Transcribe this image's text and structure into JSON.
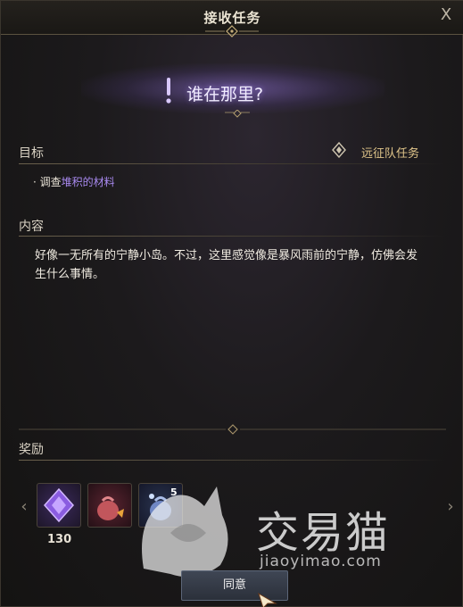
{
  "window": {
    "title": "接收任务",
    "close_label": "X"
  },
  "quest": {
    "name": "谁在那里?",
    "type_label": "远征队任务"
  },
  "objective": {
    "label": "目标",
    "bullet": "·",
    "prefix": "调查",
    "highlight": "堆积的材料"
  },
  "content": {
    "label": "内容",
    "text": "好像一无所有的宁静小岛。不过，这里感觉像是暴风雨前的宁静，仿佛会发生什么事情。"
  },
  "rewards": {
    "label": "奖励",
    "items": [
      {
        "icon": "purple-crystal-icon",
        "count": "130"
      },
      {
        "icon": "red-pouch-icon",
        "count": ""
      },
      {
        "icon": "blue-pouch-icon",
        "count": "5"
      }
    ]
  },
  "accept_button": {
    "label": "同意"
  },
  "watermark": {
    "brand": "交易猫",
    "url": "jiaoyimao.com"
  },
  "colors": {
    "accent_purple": "#a98af0",
    "quest_type_gold": "#e0c58a"
  }
}
